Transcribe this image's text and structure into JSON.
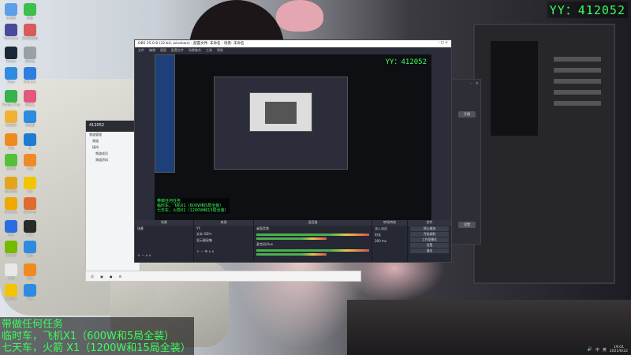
{
  "overlay": {
    "yy_id": "YY：412052",
    "lines": [
      "带做任何任务",
      "临时车，飞机X1（600W和5局全装）",
      "七天车，火箭 X1（1200W和15局全装）"
    ]
  },
  "desktop": {
    "icons": [
      {
        "label": "此电脑",
        "color": "#5aa0e8"
      },
      {
        "label": "微信",
        "color": "#3cbf4b"
      },
      {
        "label": "Visionary",
        "color": "#4a4a9a"
      },
      {
        "label": "事务管理器",
        "color": "#d85a5a"
      },
      {
        "label": "Steam",
        "color": "#1b2838"
      },
      {
        "label": "回收站",
        "color": "#9aa0a8"
      },
      {
        "label": "Edge",
        "color": "#2e8be0"
      },
      {
        "label": "安全卫士",
        "color": "#2f7de1"
      },
      {
        "label": "Google Play",
        "color": "#37b24d"
      },
      {
        "label": "网易云",
        "color": "#e25a7b"
      },
      {
        "label": "QQ音乐",
        "color": "#f2b134"
      },
      {
        "label": "浏览器",
        "color": "#2e8be0"
      },
      {
        "label": "开始",
        "color": "#ef8a1e"
      },
      {
        "label": "IE",
        "color": "#1e7bd2"
      },
      {
        "label": "加速器",
        "color": "#55c13b"
      },
      {
        "label": "火绒",
        "color": "#f08a24"
      },
      {
        "label": "软件管家",
        "color": "#e2a51d"
      },
      {
        "label": "QQ",
        "color": "#f2c500"
      },
      {
        "label": "腾讯游戏",
        "color": "#f0a800"
      },
      {
        "label": "游戏平台",
        "color": "#e06b2b"
      },
      {
        "label": "快乐",
        "color": "#2a6de0"
      },
      {
        "label": "OBS",
        "color": "#2a2a2a"
      },
      {
        "label": "NVIDIA",
        "color": "#76b900"
      },
      {
        "label": "微信",
        "color": "#2e8be0"
      },
      {
        "label": "文档",
        "color": "#e8e8e8"
      },
      {
        "label": "加速",
        "color": "#ef8a1e"
      },
      {
        "label": "QQ游戏",
        "color": "#f2c500"
      },
      {
        "label": "K歌",
        "color": "#2e8be0"
      }
    ]
  },
  "chat": {
    "title": "412052",
    "tree": [
      "频道管理",
      "频道",
      "接待",
      "频道成员",
      "频道资料"
    ]
  },
  "obs": {
    "title": "OBS 25.0.8 (32-bit, windows) - 配置文件: 未命名 - 场景: 未命名",
    "menu": [
      "文件",
      "编辑",
      "视图",
      "配置文件",
      "场景集合",
      "工具",
      "帮助"
    ],
    "preview_yy": "YY：412052",
    "preview_lines": [
      "带做任何任务",
      "临时车，飞机X1（600W和5局全装）",
      "七天车，火箭X1（1200W和15局全装）"
    ],
    "docks": {
      "scenes": {
        "header": "场景",
        "items": [
          "场景"
        ]
      },
      "sources": {
        "header": "来源",
        "items": [
          "YY",
          "文本 GDI+",
          "显示器采集"
        ]
      },
      "mixer": {
        "header": "混音器",
        "channels": [
          "桌面音频",
          "麦克风/Aux"
        ]
      },
      "transitions": {
        "header": "转场特效",
        "fade": "淡入淡出",
        "duration_label": "时长",
        "duration": "300 ms"
      },
      "controls": {
        "header": "控件",
        "buttons": [
          "停止推流",
          "开始录制",
          "工作室模式",
          "设置",
          "退出"
        ]
      }
    }
  },
  "right_app": {
    "buttons": [
      "开播",
      "设置"
    ]
  },
  "taskbar": {
    "time": "19:01",
    "date": "2021/6/22",
    "ime": "中",
    "lang": "英"
  },
  "colors": {
    "overlay_green": "#38ff5a",
    "obs_bg": "#2b2d3a"
  }
}
